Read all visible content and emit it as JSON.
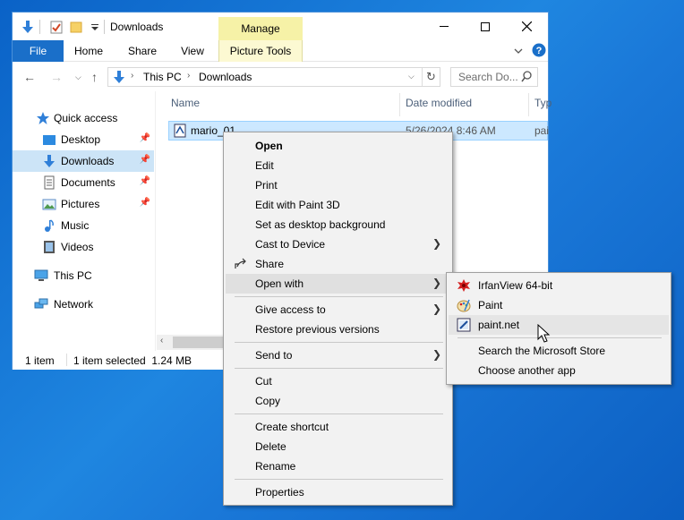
{
  "window": {
    "title": "Downloads",
    "manage_tab": "Manage",
    "ribbon_tabs": [
      "File",
      "Home",
      "Share",
      "View",
      "Picture Tools"
    ],
    "address": {
      "segments": [
        "This PC",
        "Downloads"
      ]
    },
    "search_placeholder": "Search Do..."
  },
  "nav": {
    "items": [
      {
        "label": "Quick access",
        "icon": "star-icon"
      },
      {
        "label": "Desktop",
        "icon": "desktop-folder-icon",
        "pinned": true
      },
      {
        "label": "Downloads",
        "icon": "download-arrow-icon",
        "pinned": true,
        "selected": true
      },
      {
        "label": "Documents",
        "icon": "documents-icon",
        "pinned": true
      },
      {
        "label": "Pictures",
        "icon": "pictures-icon",
        "pinned": true
      },
      {
        "label": "Music",
        "icon": "music-icon"
      },
      {
        "label": "Videos",
        "icon": "videos-icon"
      },
      {
        "label": "This PC",
        "icon": "computer-icon"
      },
      {
        "label": "Network",
        "icon": "network-icon"
      }
    ]
  },
  "content": {
    "columns": [
      "Name",
      "Date modified",
      "Typ"
    ],
    "file": {
      "name": "mario_01",
      "date": "5/26/2024 8:46 AM",
      "type": "pai"
    }
  },
  "status": {
    "count": "1 item",
    "selection": "1 item selected  1.24 MB"
  },
  "context_menu": {
    "items": [
      {
        "label": "Open",
        "bold": true
      },
      {
        "label": "Edit"
      },
      {
        "label": "Print"
      },
      {
        "label": "Edit with Paint 3D"
      },
      {
        "label": "Set as desktop background"
      },
      {
        "label": "Cast to Device",
        "submenu": true
      },
      {
        "label": "Share",
        "icon": "share-icon"
      },
      {
        "label": "Open with",
        "submenu": true,
        "hover": true
      },
      {
        "label": "Give access to",
        "submenu": true
      },
      {
        "label": "Restore previous versions"
      },
      {
        "label": "Send to",
        "submenu": true
      },
      {
        "label": "Cut"
      },
      {
        "label": "Copy"
      },
      {
        "label": "Create shortcut"
      },
      {
        "label": "Delete"
      },
      {
        "label": "Rename"
      },
      {
        "label": "Properties"
      }
    ]
  },
  "open_with": {
    "items": [
      {
        "label": "IrfanView 64-bit",
        "icon": "irfanview-icon"
      },
      {
        "label": "Paint",
        "icon": "paint-palette-icon"
      },
      {
        "label": "paint.net",
        "icon": "paintdotnet-icon",
        "hover": true
      },
      {
        "label": "Search the Microsoft Store"
      },
      {
        "label": "Choose another app"
      }
    ]
  }
}
